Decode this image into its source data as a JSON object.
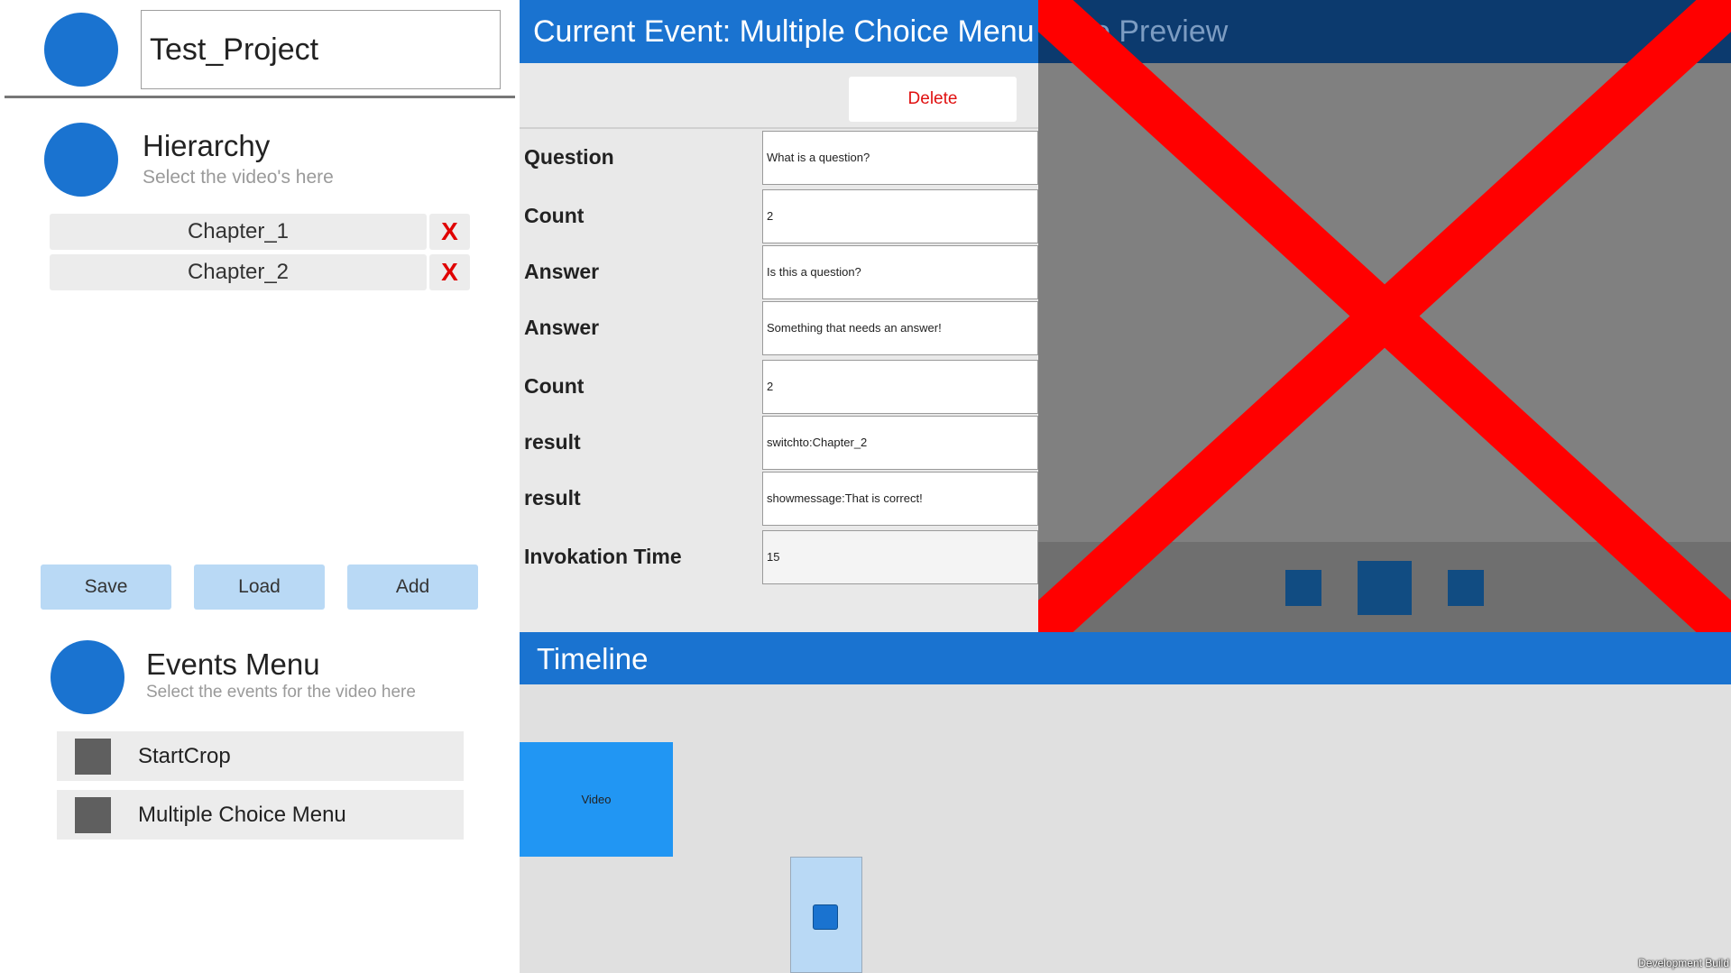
{
  "project": {
    "name": "Test_Project"
  },
  "hierarchy": {
    "title": "Hierarchy",
    "subtitle": "Select the video's here",
    "chapters": [
      {
        "label": "Chapter_1",
        "remove": "X"
      },
      {
        "label": "Chapter_2",
        "remove": "X"
      }
    ]
  },
  "actions": {
    "save": "Save",
    "load": "Load",
    "add": "Add"
  },
  "events_menu": {
    "title": "Events Menu",
    "subtitle": "Select the events for the video here",
    "items": [
      "StartCrop",
      "Multiple Choice Menu"
    ]
  },
  "current_event": {
    "title": "Current Event: Multiple Choice Menu",
    "delete": "Delete",
    "fields": [
      {
        "label": "Question",
        "value": "What is a question?"
      },
      {
        "label": "Count",
        "value": "2"
      },
      {
        "label": "Answer",
        "value": "Is this a question?"
      },
      {
        "label": "Answer",
        "value": "Something that needs an answer!"
      },
      {
        "label": "Count",
        "value": "2"
      },
      {
        "label": "result",
        "value": "switchto:Chapter_2"
      },
      {
        "label": "result",
        "value": "showmessage:That is correct!"
      },
      {
        "label": "Invokation Time",
        "value": "15"
      }
    ]
  },
  "preview": {
    "title_visible": "o Preview"
  },
  "timeline": {
    "title": "Timeline",
    "clip_label": "Video"
  },
  "footer": {
    "build": "Development Build"
  },
  "colors": {
    "accent": "#1a73d0",
    "delete": "#e01010",
    "preview_cross": "#ff0000"
  },
  "icons": [
    "avatar-circle",
    "close-x-icon",
    "event-square-icon",
    "disabled-cross-overlay"
  ]
}
